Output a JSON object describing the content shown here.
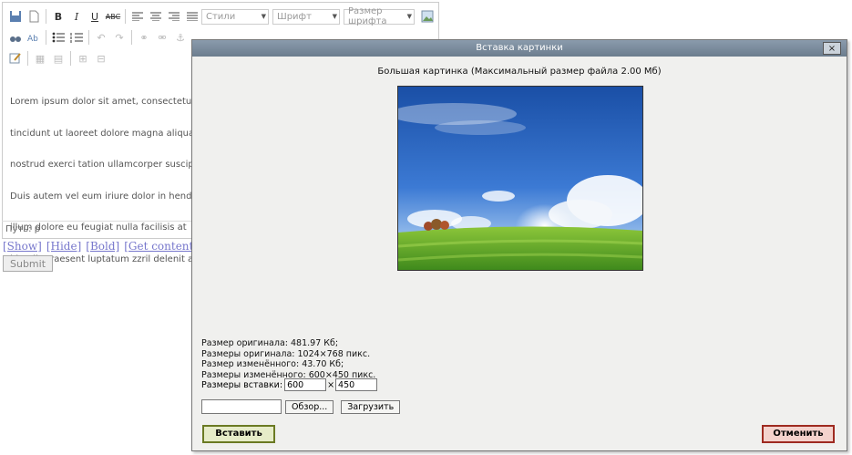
{
  "editor": {
    "toolbar": {
      "style_combo": "Стили",
      "font_combo": "Шрифт",
      "size_combo": "Размер шрифта",
      "bold_label": "B",
      "italic_label": "I",
      "underline_label": "U",
      "strike_label": "ABC"
    },
    "body_lines": [
      "Lorem ipsum dolor sit amet, consectetue",
      "tincidunt ut laoreet dolore magna aliqua",
      "nostrud exerci tation ullamcorper suscip",
      "Duis autem vel eum iriure dolor in hendr",
      "illum dolore eu feugiat nulla facilisis at",
      "blandit praesent luptatum zzril delenit a"
    ],
    "path_text": "Путь: p"
  },
  "links": [
    "[Show]",
    "[Hide]",
    "[Bold]",
    "[Get contents]",
    "["
  ],
  "submit_label": "Submit",
  "dialog": {
    "title": "Вставка картинки",
    "close_label": "×",
    "heading": "Большая картинка (Максимальный размер файла 2.00 Мб)",
    "info": {
      "orig_size": "Размер оригинала: 481.97 Кб;",
      "orig_dims": "Размеры оригинала: 1024×768 пикс.",
      "resized_size": "Размер изменённого: 43.70 Кб;",
      "resized_dims": "Размеры изменённого: 600×450 пикс."
    },
    "insert_dims_label": "Размеры вставки:",
    "width_value": "600",
    "height_value": "450",
    "dims_separator": "×",
    "browse_label": "Обзор...",
    "upload_label": "Загрузить",
    "insert_label": "Вставить",
    "cancel_label": "Отменить"
  },
  "colors": {
    "dialog_title_bar": "#7b8c9d",
    "insert_border": "#6b7a23",
    "cancel_border": "#9e2a20"
  }
}
